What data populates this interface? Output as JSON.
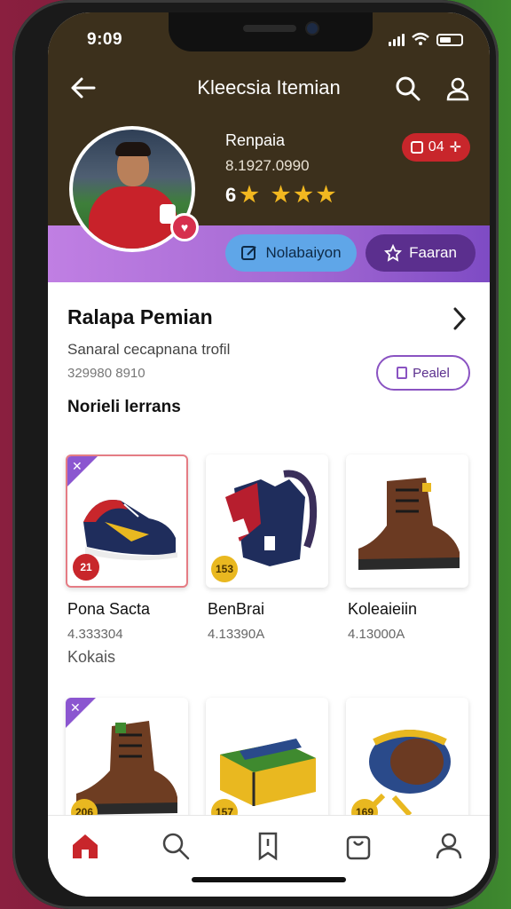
{
  "status": {
    "time": "9:09"
  },
  "header": {
    "title": "Kleecsia Itemian"
  },
  "profile": {
    "name": "Renpaia",
    "number": "8.1927.0990",
    "rating_value": "6",
    "points": "04",
    "primary_button": "Nolabaiyon",
    "secondary_button": "Faaran"
  },
  "section": {
    "title": "Ralapa Pemian",
    "subtitle": "Sanaral cecapnana trofil",
    "id_number": "329980 8910",
    "pill_label": "Pealel",
    "subheading": "Norieli lerrans"
  },
  "items_row1": [
    {
      "name": "Pona Sacta",
      "number": "4.333304",
      "price": "21",
      "icon": "sneaker-icon"
    },
    {
      "name": "BenBrai",
      "number": "4.13390A",
      "price": "153",
      "icon": "jacket-icon"
    },
    {
      "name": "Koleaieiin",
      "number": "4.13000A",
      "price": "",
      "icon": "boot-icon"
    }
  ],
  "divider_label": "Kokais",
  "items_row2": [
    {
      "price": "206",
      "icon": "boot-icon"
    },
    {
      "price": "157",
      "icon": "box-icon"
    },
    {
      "price": "169",
      "icon": "ring-icon"
    }
  ],
  "nav": [
    "home-icon",
    "search-icon",
    "bookmark-icon",
    "bag-icon",
    "profile-icon"
  ],
  "colors": {
    "accent": "#c8262b",
    "purple": "#5b2f8e",
    "header_bg": "#3c301c"
  }
}
